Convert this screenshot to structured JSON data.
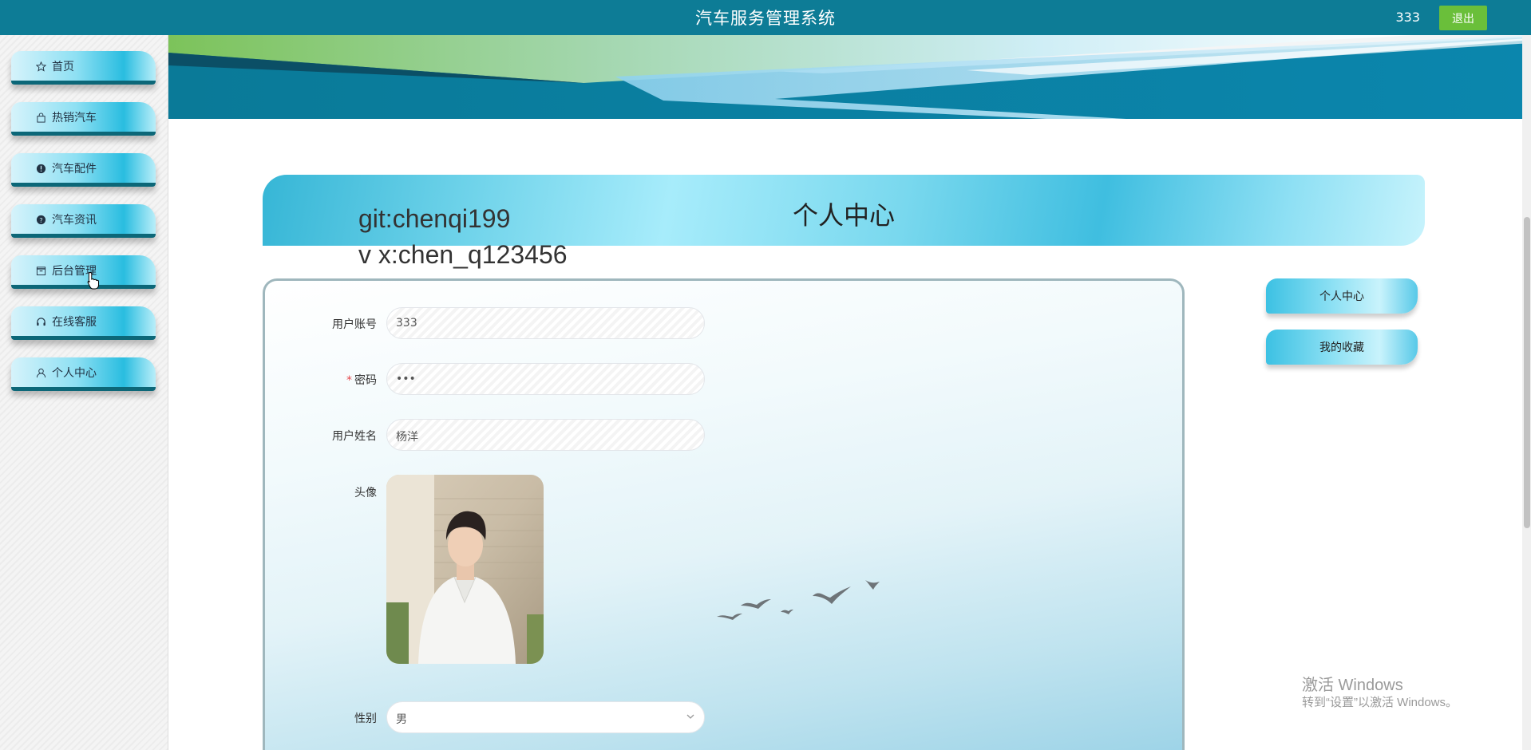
{
  "topbar": {
    "title": "汽车服务管理系统",
    "username": "333",
    "logout_label": "退出"
  },
  "sidebar": {
    "items": [
      {
        "label": "首页",
        "icon": "star-icon"
      },
      {
        "label": "热销汽车",
        "icon": "bag-icon"
      },
      {
        "label": "汽车配件",
        "icon": "info-circle-icon"
      },
      {
        "label": "汽车资讯",
        "icon": "question-circle-icon"
      },
      {
        "label": "后台管理",
        "icon": "box-icon"
      },
      {
        "label": "在线客服",
        "icon": "headset-icon"
      },
      {
        "label": "个人中心",
        "icon": "user-icon"
      }
    ]
  },
  "page": {
    "title": "个人中心",
    "overlay_line1": "git:chenqi199",
    "overlay_line2": "v x:chen_q123456"
  },
  "form": {
    "account_label": "用户账号",
    "account_value": "333",
    "password_label": "密码",
    "password_required_mark": "*",
    "password_value": "•••",
    "name_label": "用户姓名",
    "name_value": "杨洋",
    "avatar_label": "头像",
    "gender_label": "性别",
    "gender_value": "男"
  },
  "right_menu": {
    "profile_label": "个人中心",
    "favorites_label": "我的收藏"
  },
  "windows_watermark": {
    "line1": "激活 Windows",
    "line2": "转到“设置”以激活 Windows。"
  },
  "colors": {
    "topbar": "#0d7c96",
    "logout": "#6abf3a",
    "accent": "#29bde0"
  }
}
